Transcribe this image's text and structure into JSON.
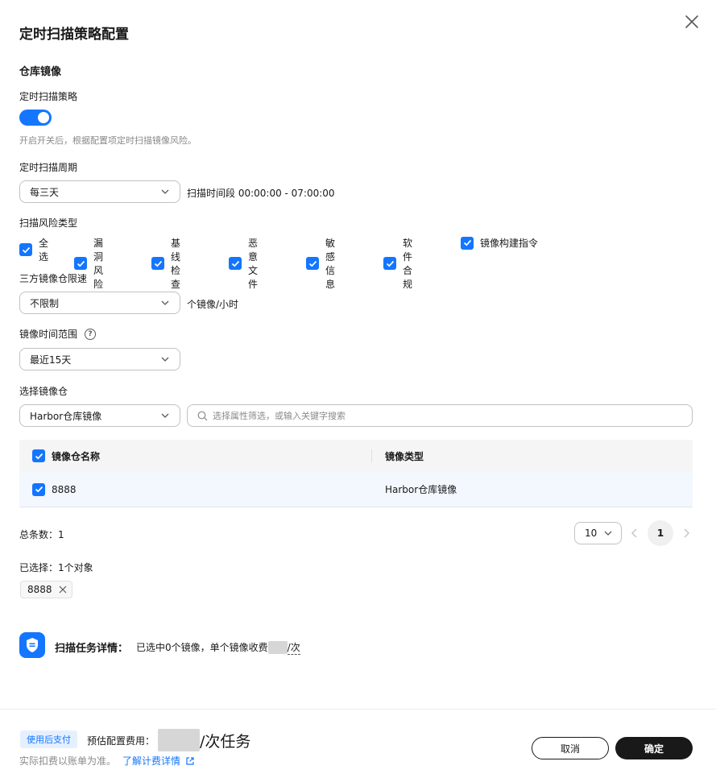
{
  "dialog": {
    "title": "定时扫描策略配置"
  },
  "section": {
    "title": "仓库镜像"
  },
  "scan_policy": {
    "label": "定时扫描策略",
    "enabled": true,
    "hint": "开启开关后，根据配置项定时扫描镜像风险。"
  },
  "scan_period": {
    "label": "定时扫描周期",
    "value": "每三天",
    "time_range_text": "扫描时间段 00:00:00 - 07:00:00"
  },
  "risk_types": {
    "label": "扫描风险类型",
    "items": [
      "全选",
      "漏洞风险",
      "基线检查",
      "恶意文件",
      "敏感信息",
      "软件合规",
      "镜像构建指令"
    ]
  },
  "rate_limit": {
    "label": "三方镜像仓限速",
    "value": "不限制",
    "unit": "个镜像/小时"
  },
  "image_time_range": {
    "label": "镜像时间范围",
    "help_icon": "question-circle-icon",
    "value": "最近15天"
  },
  "repo_select": {
    "label": "选择镜像仓",
    "value": "Harbor仓库镜像",
    "search_placeholder": "选择属性筛选，或输入关键字搜索"
  },
  "table": {
    "columns": [
      "镜像仓名称",
      "镜像类型"
    ],
    "rows": [
      {
        "name": "8888",
        "type": "Harbor仓库镜像",
        "checked": true
      }
    ]
  },
  "pagination": {
    "total_text": "总条数：1",
    "page_size": "10",
    "current_page": "1"
  },
  "selected": {
    "label": "已选择：1个对象",
    "tags": [
      "8888"
    ]
  },
  "task_detail": {
    "title": "扫描任务详情：",
    "text_before": "已选中0个镜像，单个镜像收费",
    "text_after": "/次"
  },
  "footer": {
    "pay_badge": "使用后支付",
    "fee_label": "预估配置费用：",
    "fee_unit": "/次任务",
    "note": "实际扣费以账单为准。",
    "link_text": "了解计费详情",
    "cancel": "取消",
    "confirm": "确定"
  },
  "colors": {
    "primary": "#1476ff",
    "dark": "#191919"
  }
}
